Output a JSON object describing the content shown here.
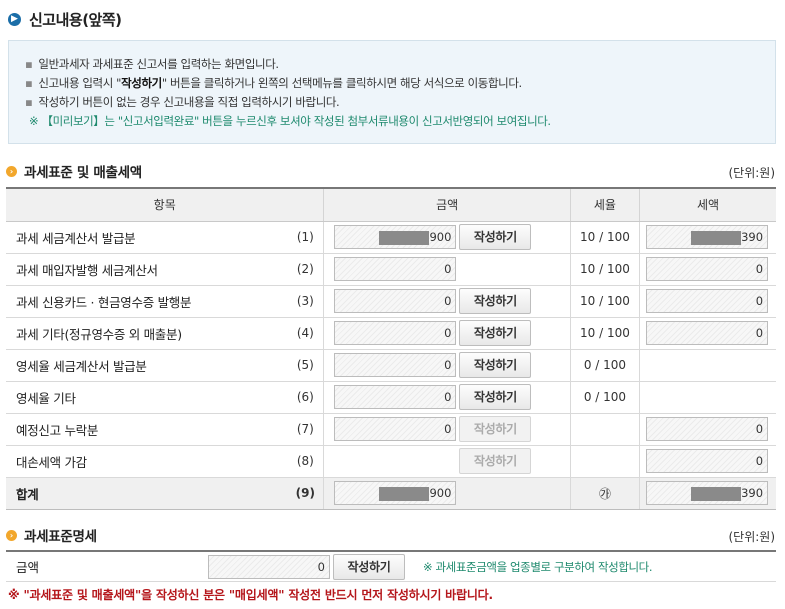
{
  "page": {
    "title": "신고내용(앞쪽)"
  },
  "info": {
    "lines": [
      "일반과세자 과세표준 신고서를 입력하는 화면입니다.",
      "작성하기 버튼이 없는 경우 신고내용을 직접 입력하시기 바랍니다."
    ],
    "line2_pre": "신고내용 입력시 \"",
    "line2_bold": "작성하기",
    "line2_post": "\" 버튼을 클릭하거나 왼쪽의 선택메뉴를 클릭하시면 해당 서식으로 이동합니다.",
    "note": "※ 【미리보기】는 \"신고서입력완료\" 버튼을 누르신후 보셔야 작성된 첨부서류내용이 신고서반영되어 보여집니다."
  },
  "section1": {
    "title": "과세표준 및 매출세액",
    "unit": "(단위:원)",
    "headers": {
      "item": "항목",
      "amount": "금액",
      "rate": "세율",
      "tax": "세액"
    },
    "write_label": "작성하기",
    "rows": [
      {
        "name": "과세 세금계산서 발급분",
        "num": "(1)",
        "amount": "900",
        "rate": "10 / 100",
        "tax": "390"
      },
      {
        "name": "과세 매입자발행 세금계산서",
        "num": "(2)",
        "amount": "0",
        "rate": "10 / 100",
        "tax": "0"
      },
      {
        "name": "과세 신용카드 · 현금영수증 발행분",
        "num": "(3)",
        "amount": "0",
        "rate": "10 / 100",
        "tax": "0"
      },
      {
        "name": "과세 기타(정규영수증 외 매출분)",
        "num": "(4)",
        "amount": "0",
        "rate": "10 / 100",
        "tax": "0"
      },
      {
        "name": "영세율 세금계산서 발급분",
        "num": "(5)",
        "amount": "0",
        "rate": "0 / 100",
        "tax": ""
      },
      {
        "name": "영세율 기타",
        "num": "(6)",
        "amount": "0",
        "rate": "0 / 100",
        "tax": ""
      },
      {
        "name": "예정신고 누락분",
        "num": "(7)",
        "amount": "0",
        "rate": "",
        "tax": "0"
      },
      {
        "name": "대손세액 가감",
        "num": "(8)",
        "amount": "",
        "rate": "",
        "tax": "0"
      }
    ],
    "total": {
      "name": "합계",
      "num": "(9)",
      "amount": "900",
      "rate": "㉮",
      "tax": "390"
    }
  },
  "section2": {
    "title": "과세표준명세",
    "unit": "(단위:원)",
    "label": "금액",
    "amount": "0",
    "write_label": "작성하기",
    "note": "※ 과세표준금액을 업종별로 구분하여 작성합니다."
  },
  "warning": "※ \"과세표준 및 매출세액\"을 작성하신 분은 \"매입세액\" 작성전 반드시 먼저 작성하시기 바랍니다.",
  "colors": {
    "accent_blue": "#1b6ea8",
    "note_green": "#1f8a6e",
    "warning_red": "#b5161b",
    "section_icon": "#f2a72c"
  }
}
